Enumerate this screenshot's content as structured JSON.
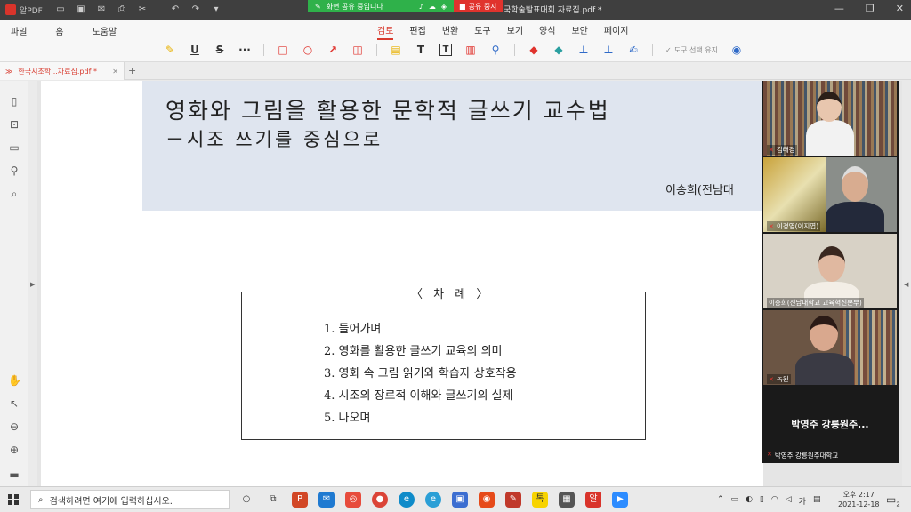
{
  "titlebar": {
    "app_name": "알PDF",
    "share_status": "화면 공유 중입니다",
    "share_stop": "공유 중지",
    "doc_title": "국학술발표대회 자료집.pdf *"
  },
  "menu": {
    "left": [
      "파일",
      "홈",
      "도움말"
    ],
    "tabs": [
      "검토",
      "편집",
      "변환",
      "도구",
      "보기",
      "양식",
      "보안",
      "페이지"
    ],
    "keep_selection": "도구 선택 유지"
  },
  "doctab": {
    "label": "한국시조학...자료집.pdf *",
    "add": "+"
  },
  "document": {
    "title": "영화와 그림을 활용한 문학적 글쓰기 교수법",
    "subtitle": "－시조 쓰기를 중심으로",
    "author": "이송희(전남대",
    "toc_title": "〈 차  례 〉",
    "toc_items": [
      "1. 들어가며",
      "2. 영화를 활용한 글쓰기 교육의 의미",
      "3. 영화 속 그림 읽기와 학습자 상호작용",
      "4. 시조의 장르적 이해와 글쓰기의 실제",
      "5. 나오며"
    ]
  },
  "video": {
    "tiles": [
      {
        "name": "김태경"
      },
      {
        "name": "이경영(이지엽)"
      },
      {
        "name": "이송희(전남대학교 교육혁신본부)"
      },
      {
        "name": "녹원"
      }
    ],
    "name_tile_big": "박영주 강릉원주...",
    "name_tile_label": "박영주 강릉원주대학교"
  },
  "taskbar": {
    "search_placeholder": "검색하려면 여기에 입력하십시오.",
    "clock_line1": "오후 2:17",
    "clock_line2": "2021-12-18",
    "ime": "가",
    "notif_count": "2"
  },
  "colors": {
    "accent": "#d83b2f",
    "share_green": "#2fb14a",
    "header_bg": "#dfe5ef"
  }
}
